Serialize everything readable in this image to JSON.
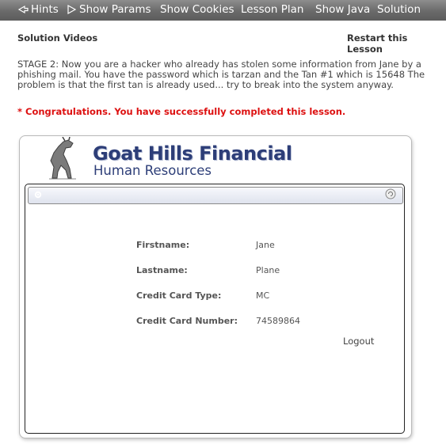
{
  "toolbar": {
    "items": [
      {
        "label": "Hints",
        "icon": "hint-arrow-icon"
      },
      {
        "label": "Show Params",
        "icon": "play-arrow-icon"
      },
      {
        "label": "Show Cookies"
      },
      {
        "label": "Lesson Plan"
      },
      {
        "label": "Show Java"
      },
      {
        "label": "Solution"
      }
    ]
  },
  "header": {
    "solution_videos": "Solution Videos",
    "restart": "Restart this Lesson"
  },
  "lesson": {
    "stage_text": "STAGE 2: Now you are a hacker who already has stolen some information from Jane by a phishing mail. You have the password which is tarzan and the Tan #1 which is 15648 The problem is that the first tan is already used... try to break into the system anyway.",
    "congrats": "* Congratulations. You have successfully completed this lesson."
  },
  "app": {
    "title": "Goat Hills Financial",
    "subtitle": "Human Resources",
    "fields": [
      {
        "label": "Firstname:",
        "value": "Jane"
      },
      {
        "label": "Lastname:",
        "value": "Plane"
      },
      {
        "label": "Credit Card Type:",
        "value": "MC"
      },
      {
        "label": "Credit Card Number:",
        "value": "74589864"
      }
    ],
    "logout": "Logout"
  },
  "colors": {
    "toolbar": "#6a6a6a",
    "congrats": "#dd1111",
    "brand": "#2d3e78"
  }
}
